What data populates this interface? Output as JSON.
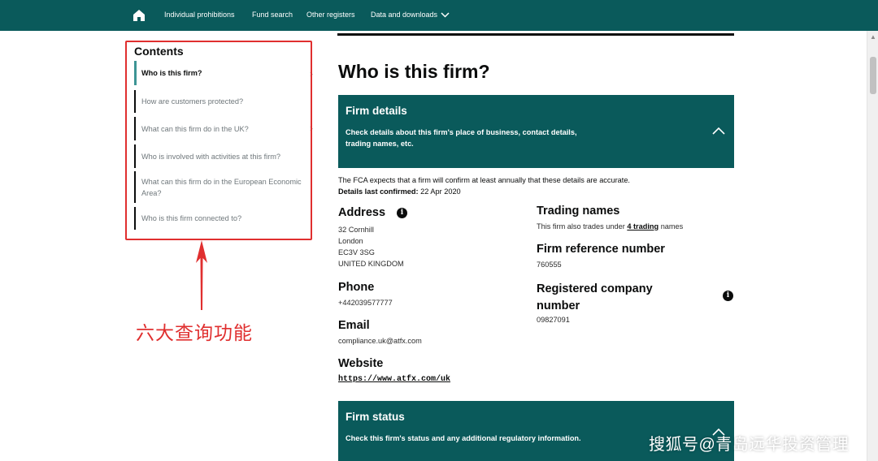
{
  "nav": {
    "items": [
      "Individual prohibitions",
      "Fund search",
      "Other registers",
      "Data and downloads"
    ]
  },
  "contents": {
    "title": "Contents",
    "items": [
      "Who is this firm?",
      "How are customers protected?",
      "What can this firm do in the UK?",
      "Who is involved with activities at this firm?",
      "What can this firm do in the European Economic Area?",
      "Who is this firm connected to?"
    ]
  },
  "annotation": "六大查询功能",
  "main": {
    "title": "Who is this firm?",
    "firm_details": {
      "title": "Firm details",
      "desc_line1": "Check details about this firm's place of business, contact details,",
      "desc_line2": "trading names, etc."
    },
    "note": "The FCA expects that a firm will confirm at least annually that these details are accurate.",
    "confirmed_label": "Details last confirmed:",
    "confirmed_value": "22 Apr 2020",
    "address": {
      "heading": "Address",
      "lines": [
        "32 Cornhill",
        "London",
        "EC3V 3SG",
        "UNITED KINGDOM"
      ]
    },
    "phone": {
      "heading": "Phone",
      "value": "+442039577777"
    },
    "email": {
      "heading": "Email",
      "value": "compliance.uk@atfx.com"
    },
    "website": {
      "heading": "Website",
      "value": "https://www.atfx.com/uk"
    },
    "trading": {
      "heading": "Trading names",
      "prefix": "This firm also trades under",
      "link": "4 trading",
      "suffix": "names"
    },
    "frn": {
      "heading": "Firm reference number",
      "value": "760555"
    },
    "company": {
      "heading_line1": "Registered company",
      "heading_line2": "number",
      "value": "09827091"
    },
    "firm_status": {
      "title": "Firm status",
      "desc": "Check this firm's status and any additional regulatory information."
    }
  },
  "watermark": "搜狐号@青岛远华投资管理",
  "colors": {
    "brand": "#0a5a5b",
    "accent": "#3d9494",
    "annotation": "#e02f2f"
  }
}
